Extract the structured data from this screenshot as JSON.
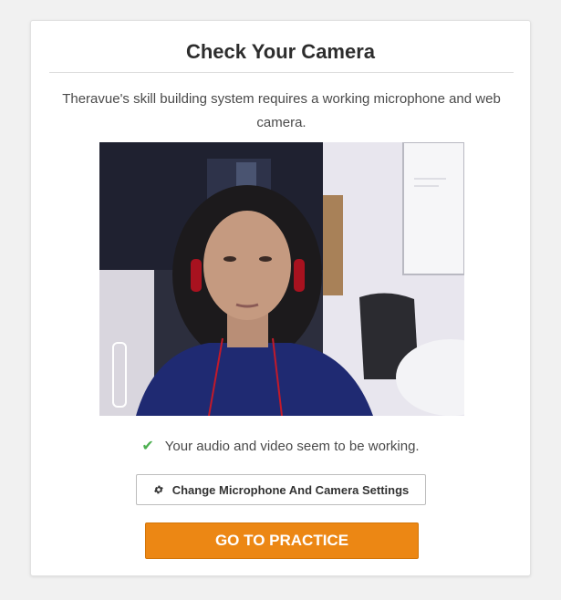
{
  "card": {
    "title": "Check Your Camera",
    "description": "Theravue's skill building system requires a working microphone and web camera."
  },
  "video": {
    "content": "webcam preview"
  },
  "status": {
    "check_icon": "check-icon",
    "text": "Your audio and video seem to be working."
  },
  "settings_button": {
    "icon": "gear-icon",
    "label": "Change Microphone And Camera Settings"
  },
  "practice_button": {
    "label": "GO TO PRACTICE"
  },
  "colors": {
    "page_background": "#f1f1f1",
    "card_background": "#ffffff",
    "accent_orange": "#ec8714",
    "success_green": "#4caf50",
    "text_dark": "#2d2d2d"
  }
}
